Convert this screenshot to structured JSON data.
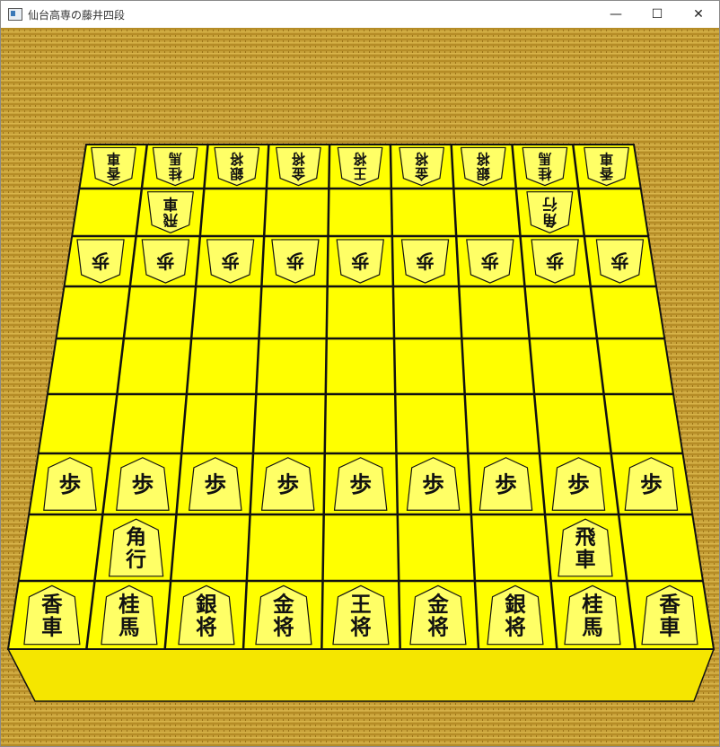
{
  "window": {
    "title": "仙台高専の藤井四段",
    "minimize_glyph": "—",
    "maximize_glyph": "☐",
    "close_glyph": "✕"
  },
  "colors": {
    "board": "#ffff00",
    "board_side": "#f5e600",
    "grid_line": "#111111",
    "piece_fill": "#ffff66",
    "piece_text": "#111111",
    "tatami": "#c8a23a",
    "tatami_dark": "#a07a1c"
  },
  "board": {
    "files": 9,
    "ranks": 9,
    "position": [
      [
        "香\n車",
        "桂\n馬",
        "銀\n将",
        "金\n将",
        "王\n将",
        "金\n将",
        "銀\n将",
        "桂\n馬",
        "香\n車"
      ],
      [
        "",
        "飛\n車",
        "",
        "",
        "",
        "",
        "",
        "角\n行",
        ""
      ],
      [
        "歩",
        "歩",
        "歩",
        "歩",
        "歩",
        "歩",
        "歩",
        "歩",
        "歩"
      ],
      [
        "",
        "",
        "",
        "",
        "",
        "",
        "",
        "",
        ""
      ],
      [
        "",
        "",
        "",
        "",
        "",
        "",
        "",
        "",
        ""
      ],
      [
        "",
        "",
        "",
        "",
        "",
        "",
        "",
        "",
        ""
      ],
      [
        "歩",
        "歩",
        "歩",
        "歩",
        "歩",
        "歩",
        "歩",
        "歩",
        "歩"
      ],
      [
        "",
        "角\n行",
        "",
        "",
        "",
        "",
        "",
        "飛\n車",
        ""
      ],
      [
        "香\n車",
        "桂\n馬",
        "銀\n将",
        "金\n将",
        "王\n将",
        "金\n将",
        "銀\n将",
        "桂\n馬",
        "香\n車"
      ]
    ],
    "gote_ranks": [
      0,
      1,
      2
    ]
  }
}
